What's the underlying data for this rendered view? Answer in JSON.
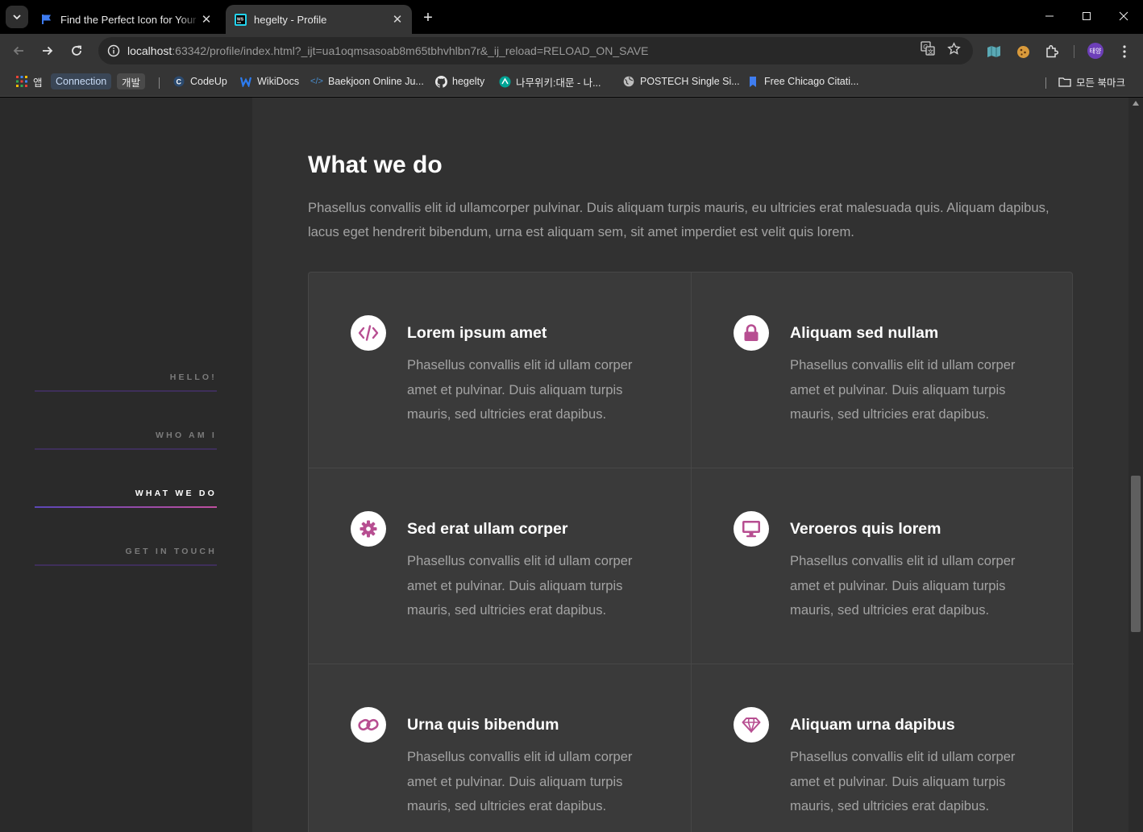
{
  "tabs": [
    {
      "title": "Find the Perfect Icon for Your Project",
      "favicon": "flag-icon",
      "active": false
    },
    {
      "title": "hegelty - Profile",
      "favicon": "webstorm-icon",
      "active": true
    }
  ],
  "address": {
    "host": "localhost",
    "rest": ":63342/profile/index.html?_ijt=ua1oqmsasoab8m65tbhvhlbn7r&_ij_reload=RELOAD_ON_SAVE"
  },
  "bookmarks": {
    "apps": "앱",
    "chip_connection": "Connection",
    "chip_dev": "개발",
    "items": [
      "CodeUp",
      "WikiDocs",
      "Baekjoon Online Ju...",
      "hegelty",
      "나무위키:대문 - 나...",
      "POSTECH Single Si...",
      "Free Chicago Citati..."
    ],
    "all": "모든 북마크"
  },
  "profile_initials": "태양",
  "sidebar": {
    "items": [
      {
        "label": "HELLO!"
      },
      {
        "label": "WHO AM I"
      },
      {
        "label": "WHAT WE DO"
      },
      {
        "label": "GET IN TOUCH"
      }
    ]
  },
  "section": {
    "title": "What we do",
    "intro": "Phasellus convallis elit id ullamcorper pulvinar. Duis aliquam turpis mauris, eu ultricies erat malesuada quis. Aliquam dapibus, lacus eget hendrerit bibendum, urna est aliquam sem, sit amet imperdiet est velit quis lorem.",
    "features": [
      {
        "title": "Lorem ipsum amet",
        "icon": "code-icon",
        "text": "Phasellus convallis elit id ullam corper amet et pulvinar. Duis aliquam turpis mauris, sed ultricies erat dapibus."
      },
      {
        "title": "Aliquam sed nullam",
        "icon": "lock-icon",
        "text": "Phasellus convallis elit id ullam corper amet et pulvinar. Duis aliquam turpis mauris, sed ultricies erat dapibus."
      },
      {
        "title": "Sed erat ullam corper",
        "icon": "gear-icon",
        "text": "Phasellus convallis elit id ullam corper amet et pulvinar. Duis aliquam turpis mauris, sed ultricies erat dapibus."
      },
      {
        "title": "Veroeros quis lorem",
        "icon": "desktop-icon",
        "text": "Phasellus convallis elit id ullam corper amet et pulvinar. Duis aliquam turpis mauris, sed ultricies erat dapibus."
      },
      {
        "title": "Urna quis bibendum",
        "icon": "link-icon",
        "text": "Phasellus convallis elit id ullam corper amet et pulvinar. Duis aliquam turpis mauris, sed ultricies erat dapibus."
      },
      {
        "title": "Aliquam urna dapibus",
        "icon": "diamond-icon",
        "text": "Phasellus convallis elit id ullam corper amet et pulvinar. Duis aliquam turpis mauris, sed ultricies erat dapibus."
      }
    ]
  },
  "colors": {
    "accent": "#b74e91",
    "nav_gradient_start": "#5b46b6",
    "nav_gradient_end": "#c04f9f",
    "background": "#313131",
    "sidebar": "#2a2a2a"
  }
}
